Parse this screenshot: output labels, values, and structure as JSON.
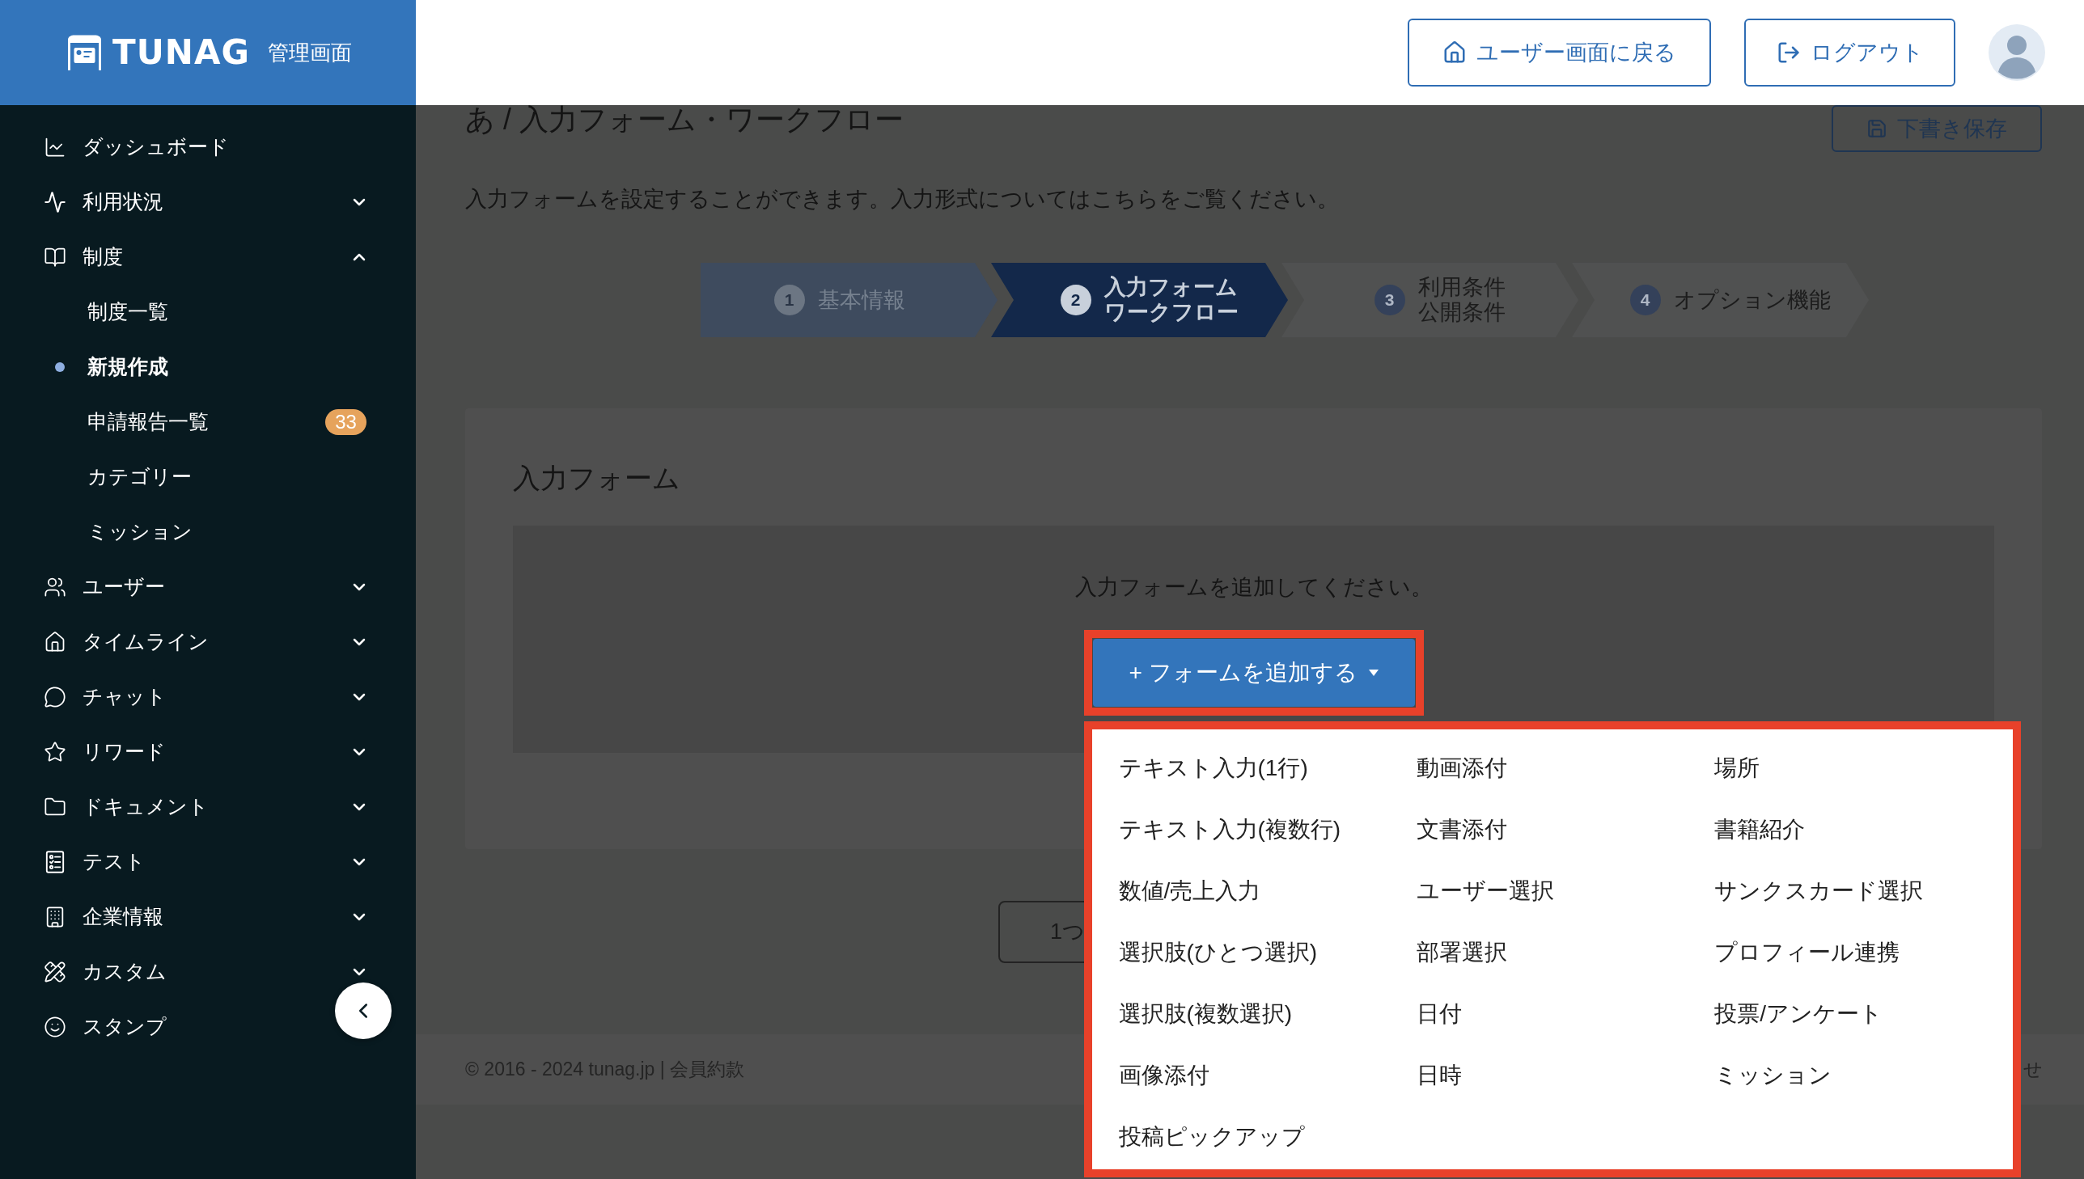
{
  "sidebar": {
    "brand": {
      "wordmark": "TUNAG",
      "subtitle": "管理画面"
    },
    "items": [
      {
        "label": "ダッシュボード"
      },
      {
        "label": "利用状況",
        "expanded": false
      },
      {
        "label": "制度",
        "expanded": true,
        "children": [
          {
            "label": "制度一覧",
            "selected": false
          },
          {
            "label": "新規作成",
            "selected": true
          },
          {
            "label": "申請報告一覧",
            "selected": false,
            "badge": "33"
          },
          {
            "label": "カテゴリー",
            "selected": false
          },
          {
            "label": "ミッション",
            "selected": false
          }
        ]
      },
      {
        "label": "ユーザー",
        "expanded": false
      },
      {
        "label": "タイムライン",
        "expanded": false
      },
      {
        "label": "チャット",
        "expanded": false
      },
      {
        "label": "リワード",
        "expanded": false
      },
      {
        "label": "ドキュメント",
        "expanded": false
      },
      {
        "label": "テスト",
        "expanded": false
      },
      {
        "label": "企業情報",
        "expanded": false
      },
      {
        "label": "カスタム",
        "expanded": false
      },
      {
        "label": "スタンプ"
      }
    ]
  },
  "header": {
    "buttons": [
      {
        "label": "ユーザー画面に戻る"
      },
      {
        "label": "ログアウト"
      }
    ]
  },
  "page": {
    "title": "あ / 入力フォーム・ワークフロー",
    "save_button": "下書き保存",
    "description": "入力フォームを設定することができます。入力形式についてはこちらをご覧ください。",
    "steps": [
      {
        "number": "1",
        "lines": [
          "基本情報"
        ],
        "selected": false,
        "completed": true
      },
      {
        "number": "2",
        "lines": [
          "入力フォーム",
          "ワークフロー"
        ],
        "selected": true,
        "completed": false
      },
      {
        "number": "3",
        "lines": [
          "利用条件",
          "公開条件"
        ],
        "selected": false,
        "completed": false
      },
      {
        "number": "4",
        "lines": [
          "オプション機能"
        ],
        "selected": false,
        "completed": false
      }
    ]
  },
  "form_section": {
    "title": "入力フォーム",
    "empty_message": "入力フォームを追加してください。",
    "add_button": {
      "label": "+ フォームを追加する",
      "highlighted": true
    },
    "menu": {
      "highlighted": true,
      "columns": [
        [
          "テキスト入力(1行)",
          "テキスト入力(複数行)",
          "数値/売上入力",
          "選択肢(ひとつ選択)",
          "選択肢(複数選択)",
          "画像添付",
          "投稿ピックアップ"
        ],
        [
          "動画添付",
          "文書添付",
          "ユーザー選択",
          "部署選択",
          "日付",
          "日時"
        ],
        [
          "場所",
          "書籍紹介",
          "サンクスカード選択",
          "プロフィール連携",
          "投票/アンケート",
          "ミッション"
        ]
      ]
    }
  },
  "partial_button": {
    "label": "1つ"
  },
  "footer": {
    "copyright": "© 2016 - 2024 tunag.jp | 会員約款",
    "trailing_text": "せ"
  }
}
